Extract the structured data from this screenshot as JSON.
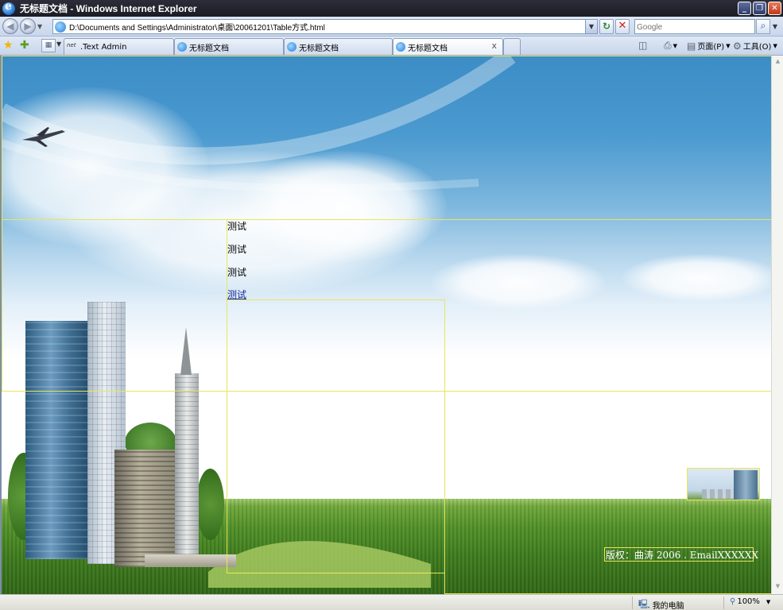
{
  "window": {
    "title": "无标题文档 - Windows Internet Explorer",
    "minimize_glyph": "_",
    "restore_glyph": "❐",
    "close_glyph": "✕"
  },
  "address_bar": {
    "back_glyph": "◀",
    "forward_glyph": "▶",
    "dropdown_glyph": "▼",
    "url": "D:\\Documents and Settings\\Administrator\\桌面\\20061201\\Table方式.html",
    "go_glyph": "↻",
    "stop_glyph": "✕",
    "search_placeholder": "Google",
    "search_glyph": "⌕"
  },
  "tabs_bar": {
    "favorites_glyph": "★",
    "add_favorites_glyph": "✚",
    "quick_tabs_glyph": "▦",
    "tabs": [
      {
        "label": ".Text Admin",
        "icon_text": "net"
      },
      {
        "label": "无标题文档"
      },
      {
        "label": "无标题文档"
      },
      {
        "label": "无标题文档",
        "close": "x"
      }
    ],
    "tools": {
      "feeds_glyph": "◫",
      "print_glyph": "⎙",
      "page_label": "页面(P)",
      "tools_label": "工具(O)",
      "chevron": "»"
    }
  },
  "page": {
    "menu_items": [
      "测试",
      "测试",
      "测试",
      "测试"
    ],
    "footer": "版权：曲涛 2006 . EmailXXXXXX"
  },
  "status_bar": {
    "zone_label": "我的电脑",
    "zoom_label": "100%"
  }
}
